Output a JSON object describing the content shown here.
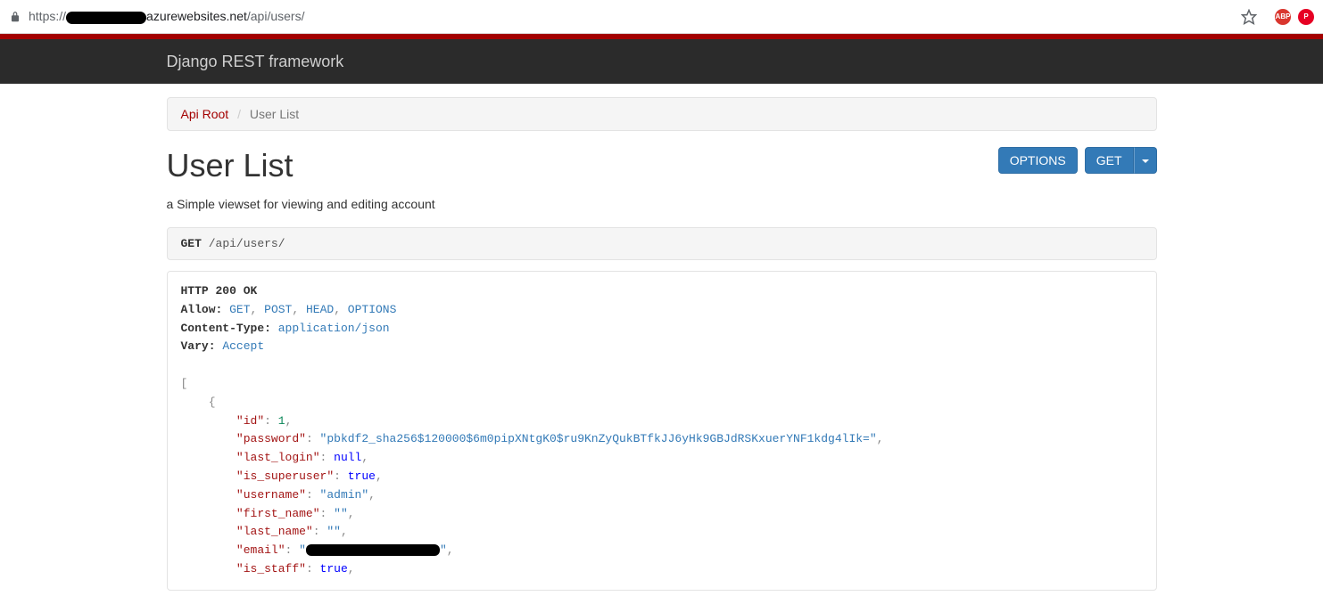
{
  "browser": {
    "url_prefix": "https://",
    "url_domain_suffix": "azurewebsites.net",
    "url_path": "/api/users/",
    "ext_abp": "ABP",
    "ext_pinterest": "P"
  },
  "navbar": {
    "brand": "Django REST framework"
  },
  "breadcrumb": {
    "root": "Api Root",
    "sep": "/",
    "current": "User List"
  },
  "page": {
    "title": "User List",
    "description": "a Simple viewset for viewing and editing account",
    "options_btn": "OPTIONS",
    "get_btn": "GET"
  },
  "request": {
    "method": "GET",
    "path": "/api/users/"
  },
  "response": {
    "status": "HTTP 200 OK",
    "headers": {
      "allow_label": "Allow:",
      "allow_values": [
        "GET",
        "POST",
        "HEAD",
        "OPTIONS"
      ],
      "content_type_label": "Content-Type:",
      "content_type_value": "application/json",
      "vary_label": "Vary:",
      "vary_value": "Accept"
    },
    "body": [
      {
        "id": 1,
        "password": "pbkdf2_sha256$120000$6m0pipXNtgK0$ru9KnZyQukBTfkJJ6yHk9GBJdRSKxuerYNF1kdg4lIk=",
        "last_login": null,
        "is_superuser": true,
        "username": "admin",
        "first_name": "",
        "last_name": "",
        "email": "[redacted]",
        "is_staff": true
      }
    ]
  }
}
